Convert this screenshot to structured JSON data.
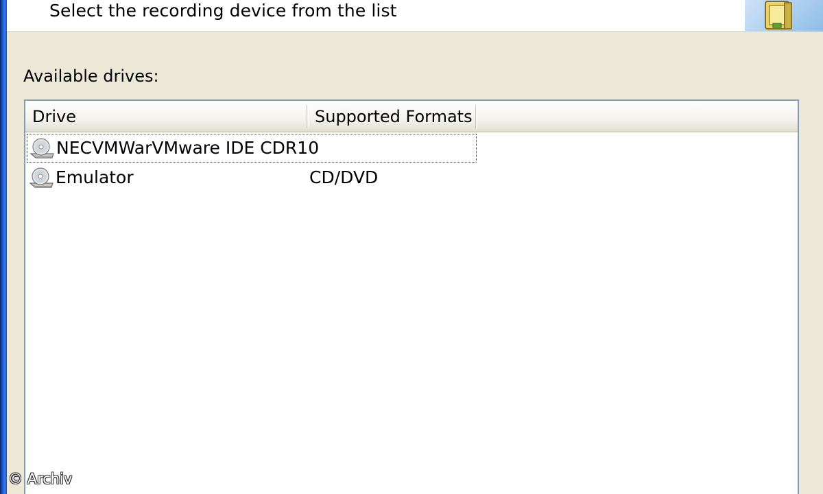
{
  "header": {
    "subtitle": "Select the recording device from the list",
    "icon": "recorder-wizard-icon"
  },
  "drives_label": "Available drives:",
  "list": {
    "columns": [
      "Drive",
      "Supported Formats"
    ],
    "rows": [
      {
        "drive": "NECVMWarVMware IDE CDR10",
        "formats": "",
        "icon": "cd-drive-icon",
        "focused": true
      },
      {
        "drive": "Emulator",
        "formats": "CD/DVD",
        "icon": "cd-drive-icon",
        "focused": false
      }
    ]
  },
  "watermark": "© Archiv",
  "colors": {
    "window_border": "#1e5bd8",
    "dialog_bg": "#ece9d8",
    "list_border": "#7f9db9"
  }
}
